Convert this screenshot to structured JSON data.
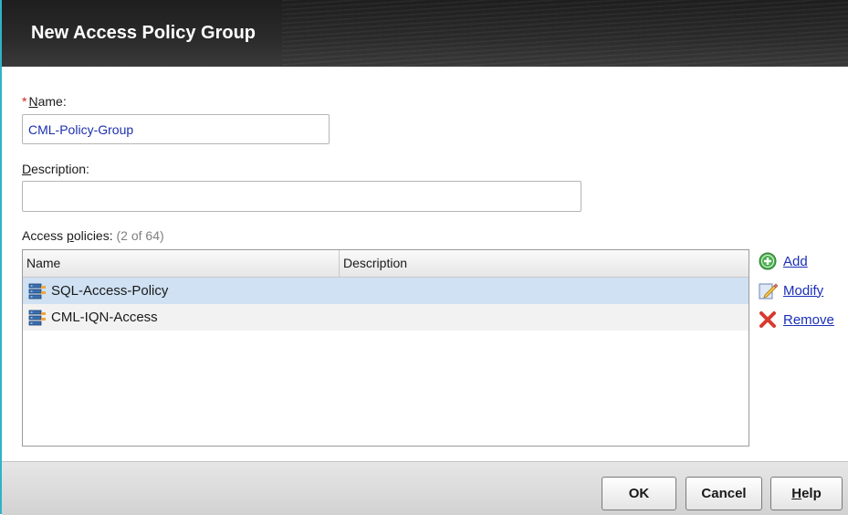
{
  "dialog": {
    "title": "New Access Policy Group"
  },
  "form": {
    "name": {
      "required_marker": "*",
      "label_mnemonic": "N",
      "label_rest": "ame:",
      "value": "CML-Policy-Group"
    },
    "description": {
      "label_mnemonic": "D",
      "label_rest": "escription:",
      "value": ""
    },
    "access_policies": {
      "label_prefix": "Access ",
      "label_mnemonic": "p",
      "label_rest": "olicies:",
      "count_text": "(2 of 64)"
    }
  },
  "table": {
    "columns": [
      "Name",
      "Description"
    ],
    "rows": [
      {
        "name": "SQL-Access-Policy",
        "description": "",
        "selected": true
      },
      {
        "name": "CML-IQN-Access",
        "description": "",
        "selected": false
      }
    ]
  },
  "actions": {
    "add": {
      "mnemonic": "A",
      "rest": "dd",
      "icon": "plus-circle-icon",
      "color": "#4caf50"
    },
    "modify": {
      "mnemonic": "M",
      "rest": "odify",
      "icon": "pencil-icon"
    },
    "remove": {
      "mnemonic": "R",
      "rest": "emove",
      "icon": "red-x-icon",
      "color": "#d83a2e"
    }
  },
  "footer": {
    "ok": "OK",
    "cancel": "Cancel",
    "help_mnemonic": "H",
    "help_rest": "elp"
  },
  "colors": {
    "accent_border": "#31b2c6",
    "selected_row": "#cfe1f2",
    "link": "#1a2fb8",
    "input_text": "#1c2fb0"
  }
}
